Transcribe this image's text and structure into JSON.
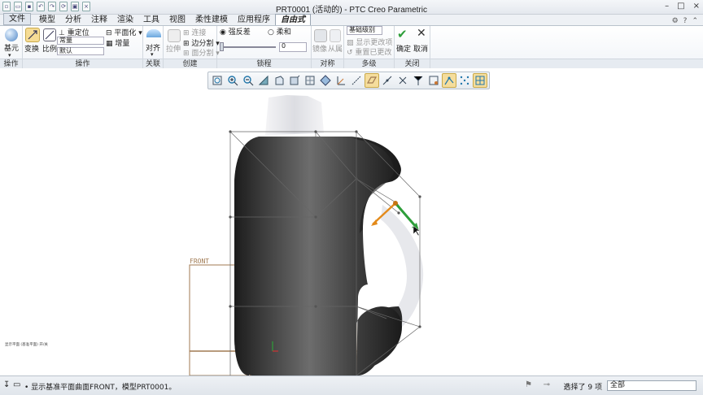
{
  "window": {
    "title": "PRT0001 (活动的) - PTC Creo Parametric"
  },
  "menu": {
    "file": "文件",
    "tabs": [
      "模型",
      "分析",
      "注释",
      "渲染",
      "工具",
      "视图",
      "柔性建模",
      "应用程序"
    ],
    "active_tab": "自由式"
  },
  "ribbon": {
    "ops": {
      "base_element": "基元",
      "label": "操作"
    },
    "manipulate": {
      "transform": "变换",
      "scale": "比例",
      "reposition": "重定位",
      "mode_value": "常量",
      "default_value": "默认",
      "planarize": "平面化",
      "increment": "增量",
      "label": "操作"
    },
    "link": {
      "align": "对齐",
      "label": "关联"
    },
    "create": {
      "extrude": "拉伸",
      "connect": "连接",
      "edge_split": "边分割",
      "face_split": "面分割",
      "label": "创建"
    },
    "contour": {
      "strong": "强反差",
      "soft": "柔和",
      "value": "0",
      "label": "锁程"
    },
    "symmetry": {
      "mirror": "镜像",
      "slave": "从属",
      "label": "对称"
    },
    "multilevel": {
      "base_level": "基础级别",
      "show_changes": "显示更改项",
      "reset_changes": "重置已更改",
      "label": "多级"
    },
    "close": {
      "ok": "确定",
      "cancel": "取消",
      "label": "关闭"
    }
  },
  "canvas": {
    "plane_label": "FRONT",
    "small_note": "显示平面 (基准平面)  开/关"
  },
  "status": {
    "message": "• 显示基准平面曲面FRONT，模型PRT0001。",
    "selected": "选择了 9 项",
    "filter": "全部"
  },
  "colors": {
    "accent_green": "#2e9e3a",
    "accent_orange": "#e38a1a",
    "plane_brown": "#a07a52"
  }
}
